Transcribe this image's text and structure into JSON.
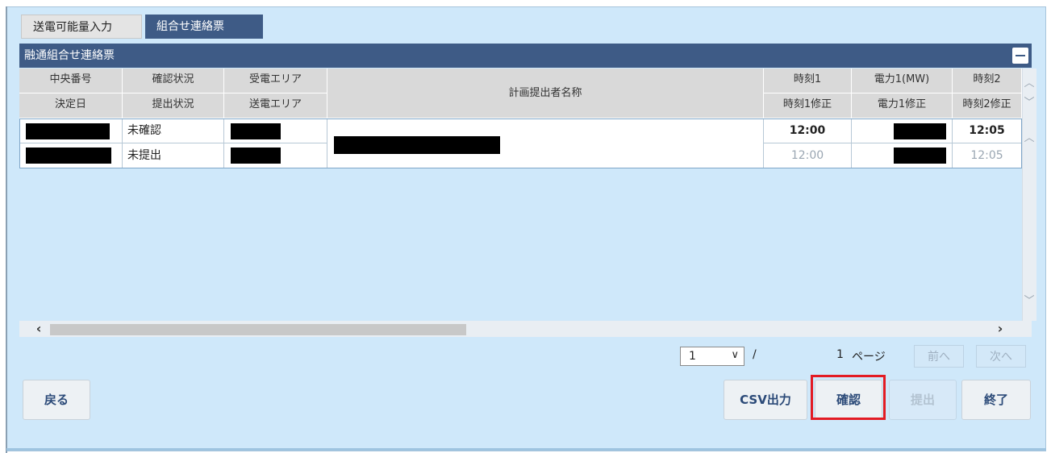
{
  "tabs": {
    "input": "送電可能量入力",
    "contact": "組合せ連絡票"
  },
  "panel": {
    "title": "融通組合せ連絡票"
  },
  "grid": {
    "header_row1": {
      "central_no": "中央番号",
      "confirm_status": "確認状況",
      "receiving_area": "受電エリア",
      "planner_name": "計画提出者名称",
      "time1": "時刻1",
      "power1": "電力1(MW)",
      "time2": "時刻2"
    },
    "header_row2": {
      "decision_date": "決定日",
      "submit_status": "提出状況",
      "sending_area": "送電エリア",
      "time1_fix": "時刻1修正",
      "power1_fix": "電力1修正",
      "time2_fix": "時刻2修正"
    },
    "rows": [
      {
        "status": "未確認",
        "time1": "12:00",
        "time2": "12:05"
      },
      {
        "status": "未提出",
        "time1": "12:00",
        "time2": "12:05"
      }
    ]
  },
  "pagination": {
    "current": "1",
    "slash": "/",
    "total": "1",
    "page_label": "ページ",
    "prev": "前へ",
    "next": "次へ"
  },
  "buttons": {
    "back": "戻る",
    "csv": "CSV出力",
    "confirm": "確認",
    "submit": "提出",
    "end": "終了"
  },
  "icons": {
    "collapse": "minus-icon",
    "scroll_up": "chevron-up-icon",
    "scroll_down": "chevron-down-icon",
    "scroll_left": "chevron-left-icon",
    "scroll_right": "chevron-right-icon"
  },
  "colors": {
    "panel_header": "#3e5b86",
    "background": "#cfe8fa",
    "highlight": "#e31b23"
  }
}
